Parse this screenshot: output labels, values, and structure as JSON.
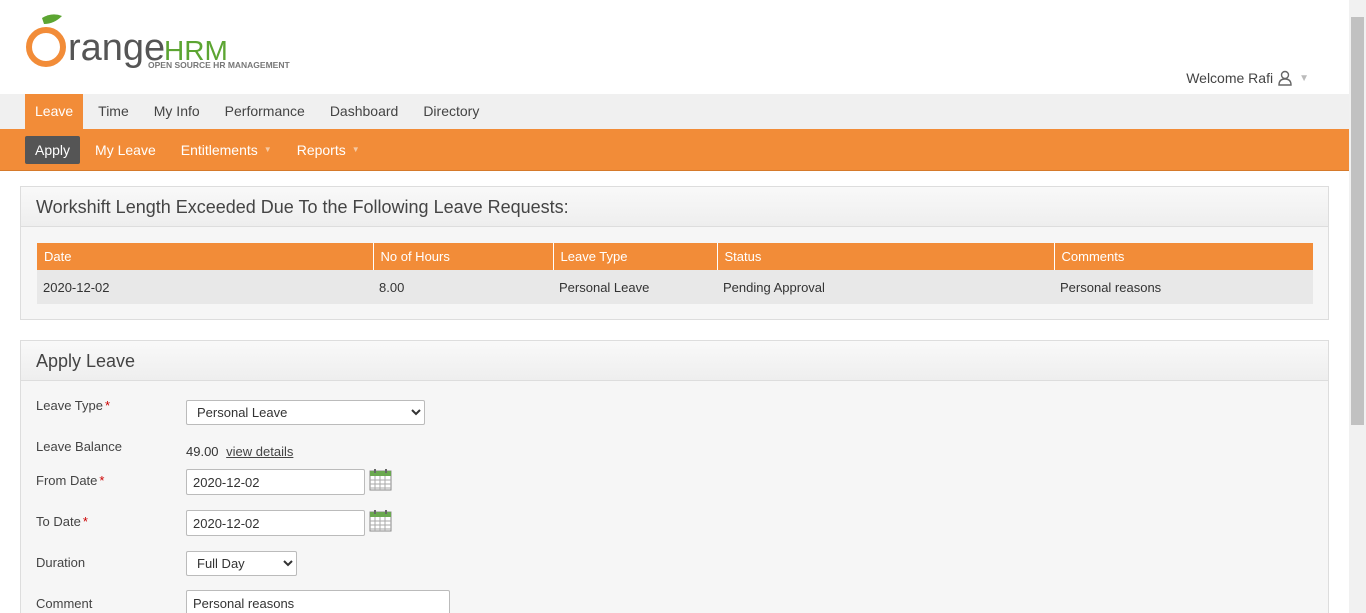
{
  "branding": {
    "logo_text_main": "range",
    "logo_text_brand": "HRM",
    "logo_tagline": "OPEN SOURCE HR MANAGEMENT",
    "welcome_text": "Welcome Rafi"
  },
  "main_menu": {
    "tabs": [
      {
        "label": "Leave"
      },
      {
        "label": "Time"
      },
      {
        "label": "My Info"
      },
      {
        "label": "Performance"
      },
      {
        "label": "Dashboard"
      },
      {
        "label": "Directory"
      }
    ]
  },
  "sub_menu": {
    "items": [
      {
        "label": "Apply"
      },
      {
        "label": "My Leave"
      },
      {
        "label": "Entitlements"
      },
      {
        "label": "Reports"
      }
    ]
  },
  "overlap_panel": {
    "title": "Workshift Length Exceeded Due To the Following Leave Requests:",
    "columns": [
      "Date",
      "No of Hours",
      "Leave Type",
      "Status",
      "Comments"
    ],
    "rows": [
      [
        "2020-12-02",
        "8.00",
        "Personal Leave",
        "Pending Approval",
        "Personal reasons"
      ]
    ]
  },
  "apply_panel": {
    "title": "Apply Leave",
    "leave_type_label": "Leave Type",
    "leave_type_value": "Personal Leave",
    "leave_balance_label": "Leave Balance",
    "leave_balance_value": "49.00",
    "view_details_link": "view details",
    "from_date_label": "From Date",
    "from_date_value": "2020-12-02",
    "to_date_label": "To Date",
    "to_date_value": "2020-12-02",
    "duration_label": "Duration",
    "duration_value": "Full Day",
    "comment_label": "Comment",
    "comment_value": "Personal reasons",
    "required_mark": "*"
  },
  "colors": {
    "accent": "#f28c38",
    "logo_green": "#5ca532",
    "submenu_active": "#555555"
  }
}
